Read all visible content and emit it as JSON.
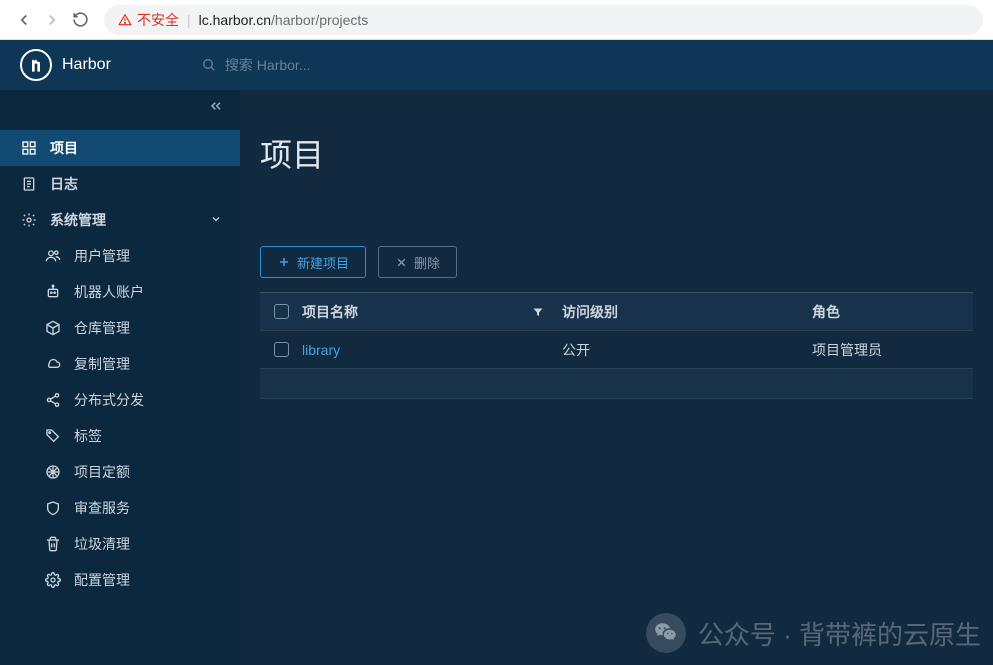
{
  "browser": {
    "insecure_label": "不安全",
    "url_host": "lc.harbor.cn",
    "url_path": "/harbor/projects"
  },
  "header": {
    "app_name": "Harbor",
    "search_placeholder": "搜索 Harbor..."
  },
  "sidebar": {
    "projects": "项目",
    "logs": "日志",
    "admin": "系统管理",
    "admin_items": {
      "users": "用户管理",
      "robots": "机器人账户",
      "repos": "仓库管理",
      "replication": "复制管理",
      "distribution": "分布式分发",
      "labels": "标签",
      "quotas": "项目定额",
      "interrogation": "审查服务",
      "gc": "垃圾清理",
      "config": "配置管理"
    }
  },
  "main": {
    "title": "项目",
    "new_project_label": "新建项目",
    "delete_label": "删除",
    "table": {
      "columns": {
        "name": "项目名称",
        "access": "访问级别",
        "role": "角色"
      },
      "rows": [
        {
          "name": "library",
          "access": "公开",
          "role": "项目管理员"
        }
      ]
    }
  },
  "watermark": "公众号 · 背带裤的云原生"
}
